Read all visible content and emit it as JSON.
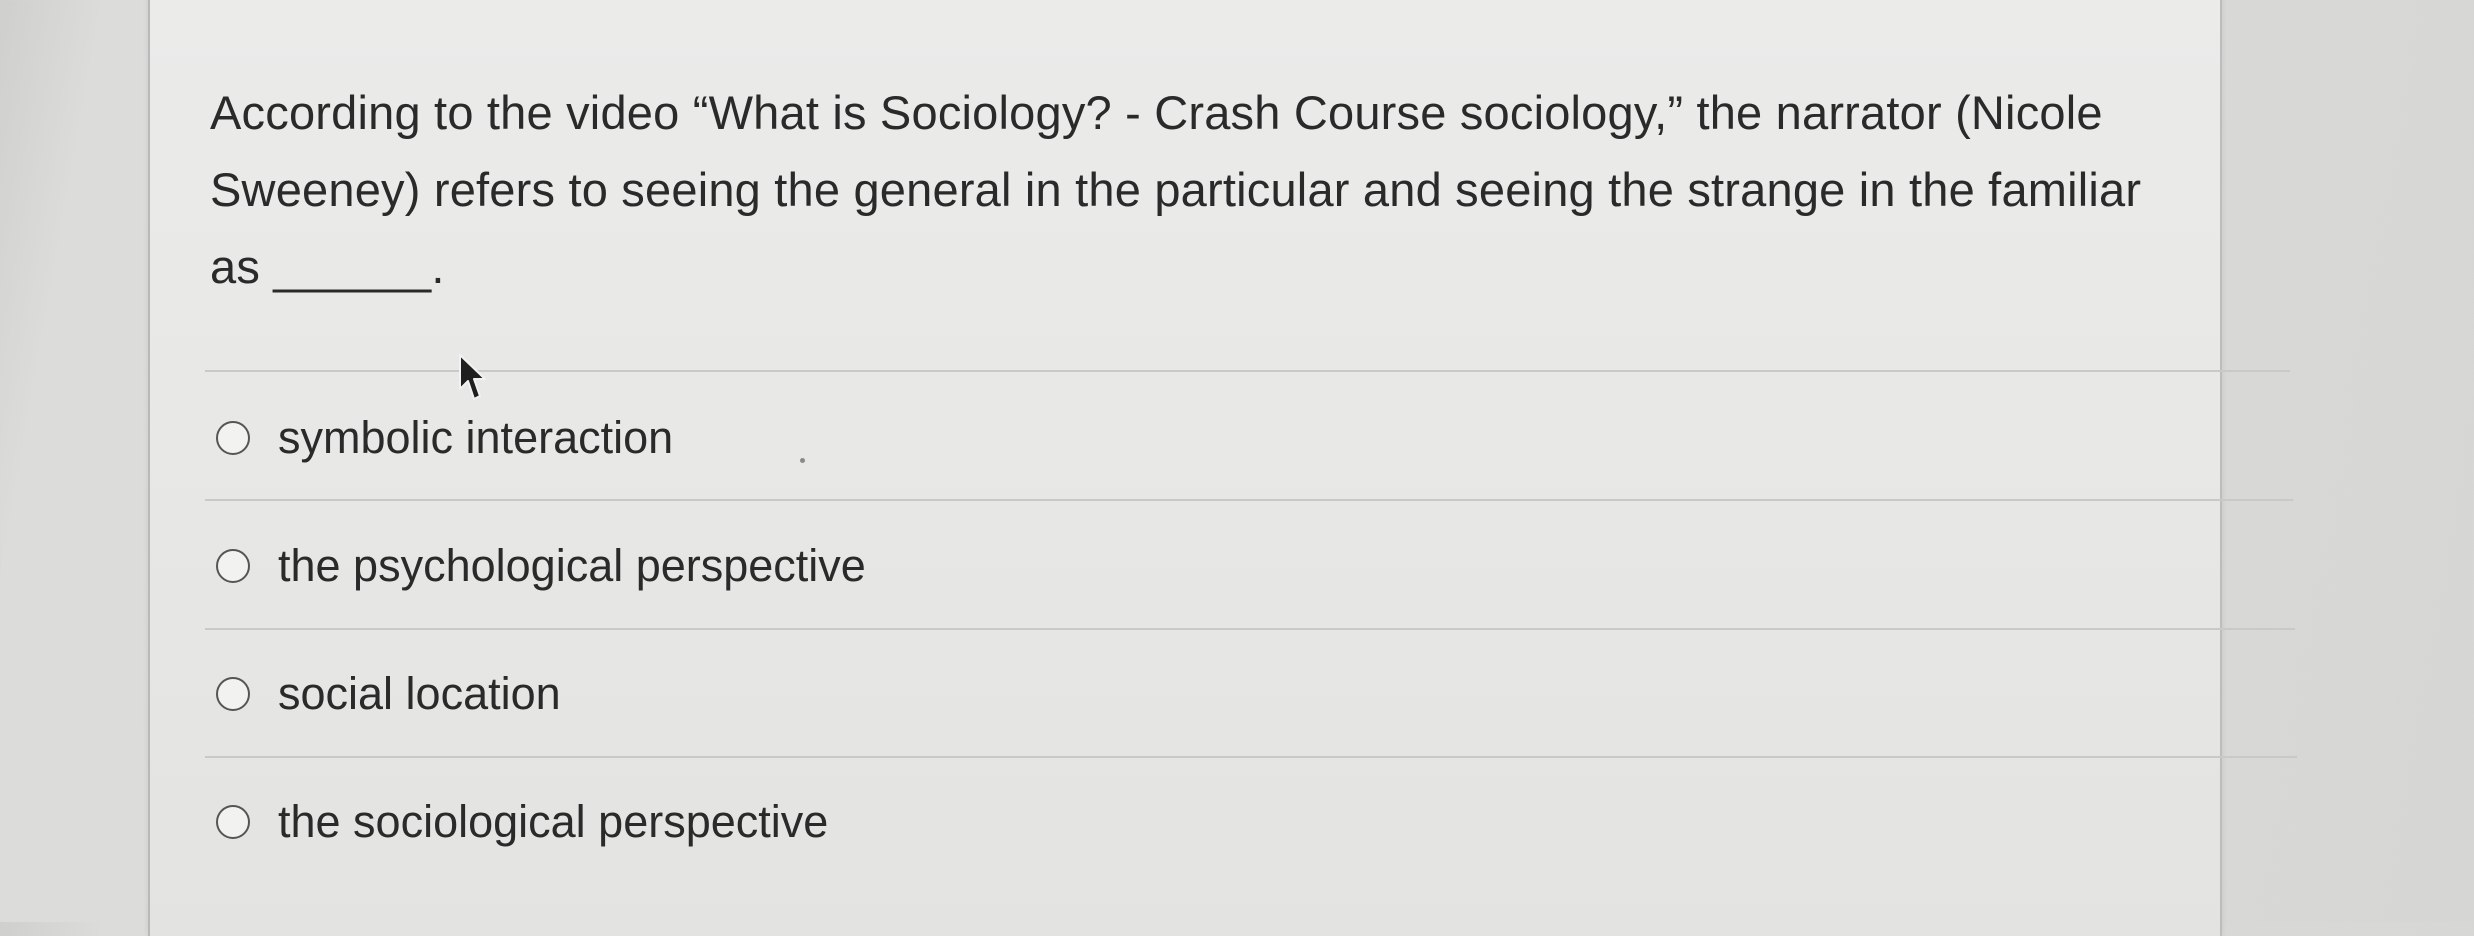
{
  "question": {
    "text": "According to the video “What is Sociology? - Crash Course sociology,” the narrator (Nicole Sweeney) refers to seeing the general in the particular and seeing the strange in the familiar as ______."
  },
  "options": [
    {
      "label": "symbolic interaction",
      "selected": false
    },
    {
      "label": "the psychological perspective",
      "selected": false
    },
    {
      "label": "social location",
      "selected": false
    },
    {
      "label": "the sociological perspective",
      "selected": false
    }
  ],
  "icons": {
    "radio": "radio-circle-icon",
    "cursor": "mouse-pointer-icon"
  },
  "colors": {
    "text": "#2a2a2a",
    "card_background": "#e9e9e7",
    "divider": "#c9c9c7",
    "radio_border": "#555555"
  }
}
